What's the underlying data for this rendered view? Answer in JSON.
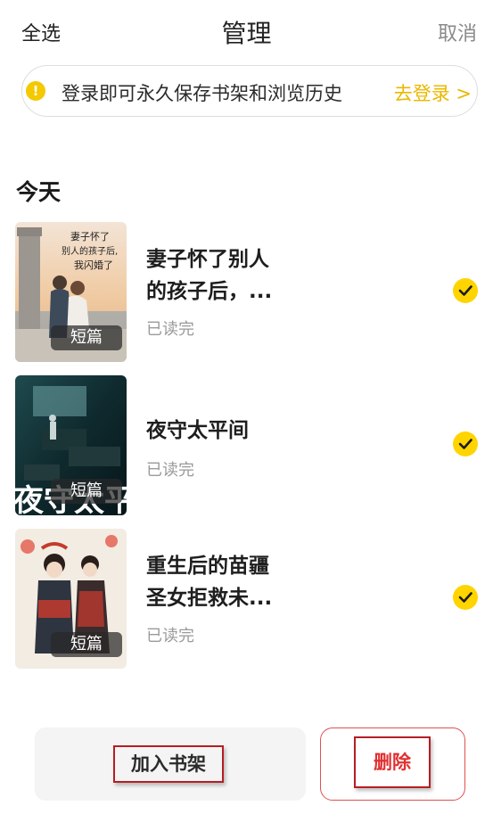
{
  "header": {
    "select_all": "全选",
    "title": "管理",
    "cancel": "取消"
  },
  "banner": {
    "icon": "exclamation-icon",
    "message": "登录即可永久保存书架和浏览历史",
    "action": "去登录 >",
    "accent_color": "#e9b800"
  },
  "section": {
    "title": "今天"
  },
  "books": [
    {
      "title": "妻子怀了别人的孩子后，...",
      "title_line1": "妻子怀了别人",
      "title_line2": "的孩子后，...",
      "status": "已读完",
      "tag": "短篇",
      "cover_text": [
        "妻子怀了",
        "别人的孩子后,",
        "我闪婚了"
      ],
      "selected": true
    },
    {
      "title": "夜守太平间",
      "title_line1": "夜守太平间",
      "title_line2": "",
      "status": "已读完",
      "tag": "短篇",
      "cover_text": [
        "夜守太平间"
      ],
      "selected": true
    },
    {
      "title": "重生后的苗疆圣女拒救未...",
      "title_line1": "重生后的苗疆",
      "title_line2": "圣女拒救未...",
      "status": "已读完",
      "tag": "短篇",
      "cover_text": [],
      "selected": true
    }
  ],
  "footer": {
    "add_to_shelf": "加入书架",
    "delete": "删除",
    "delete_color": "#e03030"
  }
}
